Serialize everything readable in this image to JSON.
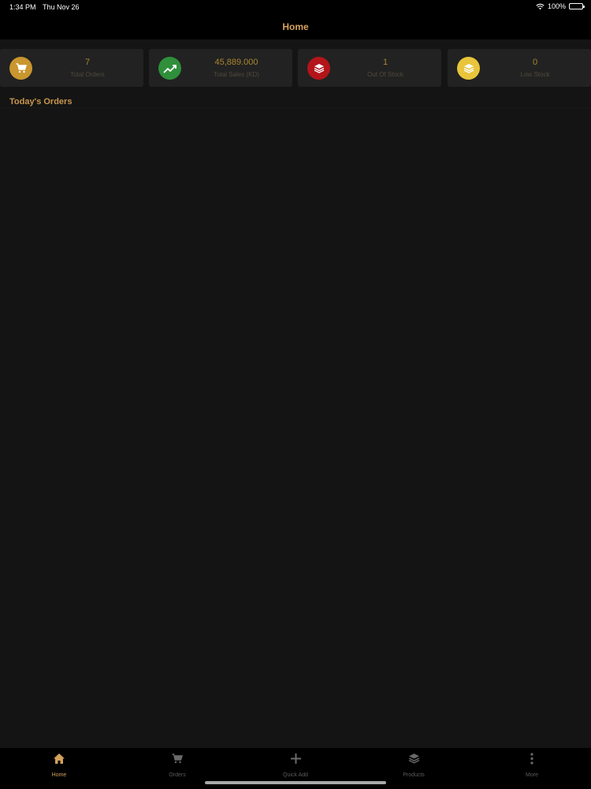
{
  "status_bar": {
    "time": "1:34 PM",
    "date": "Thu Nov 26",
    "battery": "100%",
    "battery_level": 1.0,
    "wifi_icon": "wifi-icon",
    "battery_icon": "battery-icon"
  },
  "nav": {
    "title": "Home"
  },
  "stats": [
    {
      "value": "7",
      "label": "Total Orders",
      "icon": "cart-icon",
      "color": "#c9962f"
    },
    {
      "value": "45,889.000",
      "label": "Total Sales (KD)",
      "icon": "trending-up-icon",
      "color": "#2f8f3a"
    },
    {
      "value": "1",
      "label": "Out Of Stock",
      "icon": "layers-icon",
      "color": "#b3151a"
    },
    {
      "value": "0",
      "label": "Low Stock",
      "icon": "layers-icon",
      "color": "#e8c53a"
    }
  ],
  "section": {
    "title": "Today's Orders"
  },
  "tabs": [
    {
      "label": "Home",
      "icon": "home-icon",
      "active": true
    },
    {
      "label": "Orders",
      "icon": "cart-icon",
      "active": false
    },
    {
      "label": "Quick Add",
      "icon": "plus-icon",
      "active": false
    },
    {
      "label": "Products",
      "icon": "layers-icon",
      "active": false
    },
    {
      "label": "More",
      "icon": "more-vertical-icon",
      "active": false
    }
  ],
  "colors": {
    "accent": "#d4a15a",
    "background": "#141414",
    "card": "#222222",
    "bar": "#000000"
  }
}
